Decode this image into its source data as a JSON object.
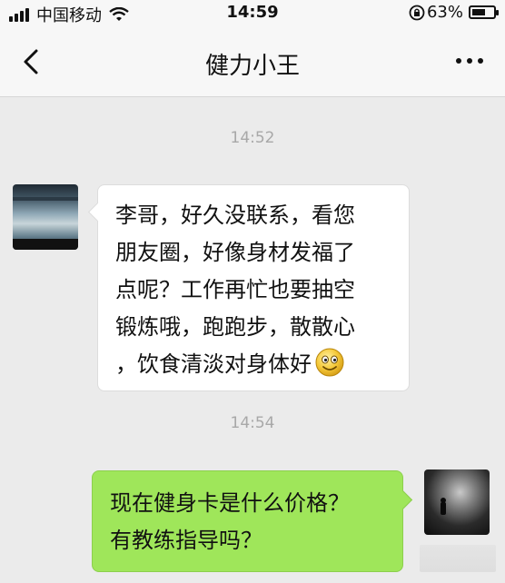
{
  "status_bar": {
    "carrier": "中国移动",
    "time": "14:59",
    "battery_text": "63%",
    "battery_level": 0.63,
    "icons": [
      "signal-icon",
      "wifi-icon",
      "orientation-lock-icon",
      "battery-icon"
    ]
  },
  "nav": {
    "title": "健力小王",
    "back_icon": "chevron-left-icon",
    "more_icon": "more-dots-icon"
  },
  "messages": [
    {
      "timestamp": "14:52",
      "side": "left",
      "sender_avatar": "gym-photo-avatar",
      "lines": [
        "李哥，好久没联系，看您",
        "朋友圈，好像身材发福了",
        "点呢？工作再忙也要抽空",
        "锻炼哦，跑跑步，散散心",
        "，饮食清淡对身体好"
      ],
      "trailing_emoji": "smile-emoji-icon"
    },
    {
      "timestamp": "14:54",
      "side": "right",
      "sender_avatar": "runner-photo-avatar",
      "lines": [
        "现在健身卡是什么价格？",
        "有教练指导吗？"
      ]
    }
  ],
  "colors": {
    "background": "#ebebeb",
    "nav_background": "#f7f7f7",
    "sent_bubble": "#9fe65a",
    "received_bubble": "#ffffff",
    "timestamp_text": "#a8a8a8"
  }
}
